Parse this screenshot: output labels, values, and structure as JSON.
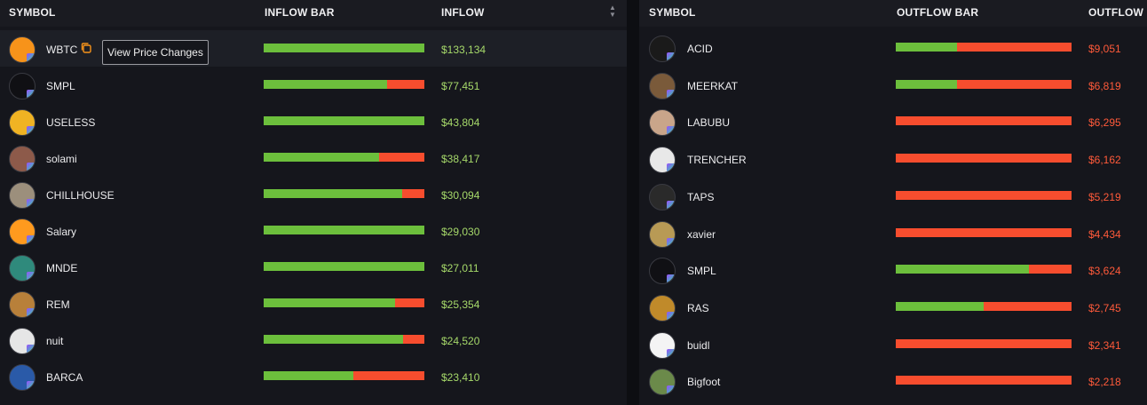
{
  "inflow": {
    "headers": {
      "symbol": "SYMBOL",
      "bar": "INFLOW BAR",
      "value": "INFLOW"
    },
    "tooltip": "View Price Changes",
    "rows": [
      {
        "symbol": "WBTC",
        "value": "$133,134",
        "inflow_share": 1.0,
        "avatar_color": "#f7931a",
        "icon": "bitcoin-icon"
      },
      {
        "symbol": "SMPL",
        "value": "$77,451",
        "inflow_share": 0.77,
        "avatar_color": "#101014",
        "icon": "smpl-token-icon"
      },
      {
        "symbol": "USELESS",
        "value": "$43,804",
        "inflow_share": 1.0,
        "avatar_color": "#f0b323",
        "icon": "useless-token-icon"
      },
      {
        "symbol": "solami",
        "value": "$38,417",
        "inflow_share": 0.72,
        "avatar_color": "#8d5a4a",
        "icon": "solami-token-icon"
      },
      {
        "symbol": "CHILLHOUSE",
        "value": "$30,094",
        "inflow_share": 0.86,
        "avatar_color": "#9c8f7c",
        "icon": "chillhouse-token-icon"
      },
      {
        "symbol": "Salary",
        "value": "$29,030",
        "inflow_share": 1.0,
        "avatar_color": "#ff9a1e",
        "icon": "salary-token-icon"
      },
      {
        "symbol": "MNDE",
        "value": "$27,011",
        "inflow_share": 1.0,
        "avatar_color": "#2f8a7c",
        "icon": "mnde-token-icon"
      },
      {
        "symbol": "REM",
        "value": "$25,354",
        "inflow_share": 0.82,
        "avatar_color": "#b8803a",
        "icon": "rem-token-icon"
      },
      {
        "symbol": "nuit",
        "value": "$24,520",
        "inflow_share": 0.87,
        "avatar_color": "#e6e6e6",
        "icon": "nuit-token-icon"
      },
      {
        "symbol": "BARCA",
        "value": "$23,410",
        "inflow_share": 0.56,
        "avatar_color": "#2a5aa8",
        "icon": "barca-token-icon"
      }
    ]
  },
  "outflow": {
    "headers": {
      "symbol": "SYMBOL",
      "bar": "OUTFLOW BAR",
      "value": "OUTFLOW"
    },
    "rows": [
      {
        "symbol": "ACID",
        "value": "$9,051",
        "inflow_share": 0.35,
        "avatar_color": "#1a1a1a",
        "icon": "acid-token-icon"
      },
      {
        "symbol": "MEERKAT",
        "value": "$6,819",
        "inflow_share": 0.35,
        "avatar_color": "#7a5a3a",
        "icon": "meerkat-token-icon"
      },
      {
        "symbol": "LABUBU",
        "value": "$6,295",
        "inflow_share": 0.0,
        "avatar_color": "#c9a58a",
        "icon": "labubu-token-icon"
      },
      {
        "symbol": "TRENCHER",
        "value": "$6,162",
        "inflow_share": 0.0,
        "avatar_color": "#e8e8e8",
        "icon": "trencher-token-icon"
      },
      {
        "symbol": "TAPS",
        "value": "$5,219",
        "inflow_share": 0.0,
        "avatar_color": "#2a2a2a",
        "icon": "taps-token-icon"
      },
      {
        "symbol": "xavier",
        "value": "$4,434",
        "inflow_share": 0.0,
        "avatar_color": "#b89a55",
        "icon": "xavier-token-icon"
      },
      {
        "symbol": "SMPL",
        "value": "$3,624",
        "inflow_share": 0.76,
        "avatar_color": "#101014",
        "icon": "smpl-token-icon"
      },
      {
        "symbol": "RAS",
        "value": "$2,745",
        "inflow_share": 0.5,
        "avatar_color": "#c08a2a",
        "icon": "ras-token-icon"
      },
      {
        "symbol": "buidl",
        "value": "$2,341",
        "inflow_share": 0.0,
        "avatar_color": "#f4f4f4",
        "icon": "buidl-token-icon"
      },
      {
        "symbol": "Bigfoot",
        "value": "$2,218",
        "inflow_share": 0.0,
        "avatar_color": "#6b8a4a",
        "icon": "bigfoot-token-icon"
      }
    ]
  },
  "colors": {
    "inflow": "#6cbf3c",
    "outflow": "#f74d2e",
    "inflow_text": "#a6d96a",
    "outflow_text": "#ff5a3a"
  }
}
